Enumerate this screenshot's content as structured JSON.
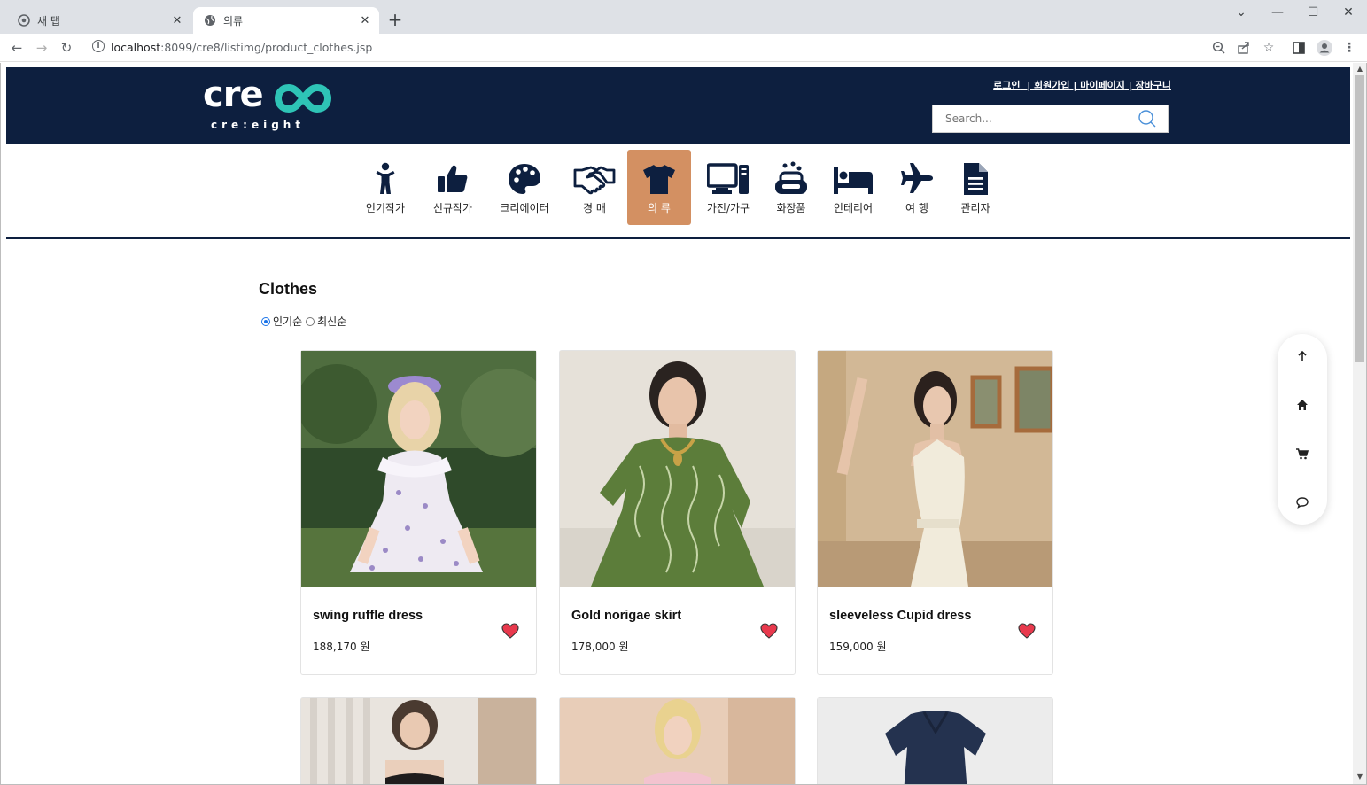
{
  "browser": {
    "tabs": [
      {
        "title": "새 탭",
        "active": false
      },
      {
        "title": "의류",
        "active": true
      }
    ],
    "url_host": "localhost",
    "url_rest": ":8099/cre8/listimg/product_clothes.jsp"
  },
  "header": {
    "logo_word": "cre",
    "logo_sub": "cre:eight",
    "links": [
      "로그인",
      "회원가입",
      "마이페이지",
      "장바구니"
    ],
    "search_placeholder": "Search..."
  },
  "categories": [
    {
      "label": "인기작가",
      "icon": "person-icon",
      "active": false
    },
    {
      "label": "신규작가",
      "icon": "thumbs-up-icon",
      "active": false
    },
    {
      "label": "크리에이터",
      "icon": "palette-icon",
      "active": false
    },
    {
      "label": "경 매",
      "icon": "handshake-icon",
      "active": false
    },
    {
      "label": "의 류",
      "icon": "shirt-icon",
      "active": true
    },
    {
      "label": "가전/가구",
      "icon": "computer-icon",
      "active": false
    },
    {
      "label": "화장품",
      "icon": "soap-icon",
      "active": false
    },
    {
      "label": "인테리어",
      "icon": "bed-icon",
      "active": false
    },
    {
      "label": "여 행",
      "icon": "plane-icon",
      "active": false
    },
    {
      "label": "관리자",
      "icon": "file-icon",
      "active": false
    }
  ],
  "page": {
    "title": "Clothes",
    "sort_options": [
      {
        "label": "인기순",
        "checked": true
      },
      {
        "label": "최신순",
        "checked": false
      }
    ]
  },
  "products": [
    {
      "name": "swing ruffle dress",
      "price": "188,170 원",
      "liked": true
    },
    {
      "name": "Gold norigae skirt",
      "price": "178,000 원",
      "liked": true
    },
    {
      "name": "sleeveless Cupid dress",
      "price": "159,000 원",
      "liked": true
    }
  ],
  "float_bar": [
    "arrow-up-icon",
    "home-icon",
    "cart-icon",
    "chat-icon"
  ],
  "colors": {
    "header_bg": "#0d1f3f",
    "active_category": "#d39062",
    "logo_accent": "#2ec4b6",
    "heart": "#e8394d"
  }
}
